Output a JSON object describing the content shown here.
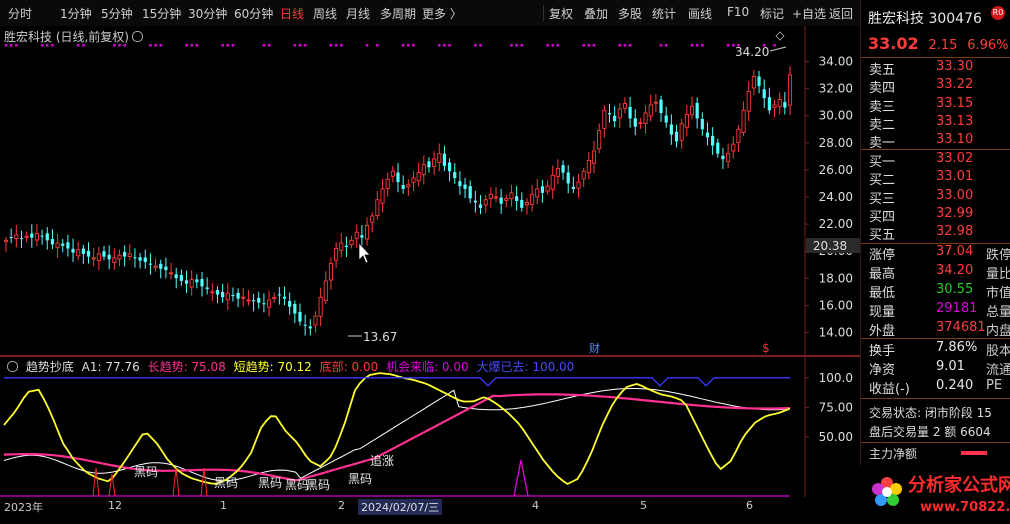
{
  "toolbar": {
    "left": [
      "分时",
      "1分钟",
      "5分钟",
      "15分钟",
      "30分钟",
      "60分钟",
      "日线",
      "周线",
      "月线",
      "多周期",
      "更多 〉"
    ],
    "active": "日线",
    "right": [
      "复权",
      "叠加",
      "多股",
      "统计",
      "画线",
      "F10",
      "标记",
      "+自选",
      "返回"
    ]
  },
  "chart_title": "胜宏科技 (日线,前复权)",
  "stock": {
    "name": "胜宏科技",
    "code": "300476",
    "badge": "R0",
    "price": "33.02",
    "change": "2.15",
    "pct": "6.96%"
  },
  "orderbook": {
    "asks": [
      {
        "label": "卖五",
        "price": "33.30"
      },
      {
        "label": "卖四",
        "price": "33.22"
      },
      {
        "label": "卖三",
        "price": "33.15"
      },
      {
        "label": "卖二",
        "price": "33.13"
      },
      {
        "label": "卖一",
        "price": "33.10"
      }
    ],
    "bids": [
      {
        "label": "买一",
        "price": "33.02"
      },
      {
        "label": "买二",
        "price": "33.01"
      },
      {
        "label": "买三",
        "price": "33.00"
      },
      {
        "label": "买四",
        "price": "32.99"
      },
      {
        "label": "买五",
        "price": "32.98"
      }
    ]
  },
  "quote": [
    {
      "label": "涨停",
      "value": "37.04",
      "color": "red",
      "extra": "跌停"
    },
    {
      "label": "最高",
      "value": "34.20",
      "color": "red",
      "extra": "量比"
    },
    {
      "label": "最低",
      "value": "30.55",
      "color": "green",
      "extra": "市值"
    },
    {
      "label": "现量",
      "value": "29181",
      "color": "purple",
      "extra": "总量"
    },
    {
      "label": "外盘",
      "value": "374681",
      "color": "red",
      "extra": "内盘"
    }
  ],
  "stats": [
    {
      "label": "换手",
      "value": "7.86%",
      "extra": "股本"
    },
    {
      "label": "净资",
      "value": "9.01",
      "extra": "流通"
    },
    {
      "label": "收益(-)",
      "value": "0.240",
      "extra": "PE"
    }
  ],
  "trading_state": "交易状态: 闭市阶段 15",
  "after_hours": "盘后交易量 2 额 6604",
  "main_net": "主力净额",
  "logo": {
    "text": "分析家公式网",
    "url": "www.70822.com"
  },
  "y_axis": {
    "ticks": [
      "34.00",
      "32.00",
      "30.00",
      "28.00",
      "26.00",
      "24.00",
      "22.00",
      "20.00",
      "18.00",
      "16.00",
      "14.00"
    ],
    "cursor": "20.38"
  },
  "annotations": {
    "high": "34.20",
    "low": "13.67",
    "cai": "财",
    "s": "$"
  },
  "indicator": {
    "name": "趋势抄底",
    "a1": "A1: 77.76",
    "long": "长趋势: 75.08",
    "short": "短趋势: 70.12",
    "bottom": "底部: 0.00",
    "chance": "机会来临: 0.00",
    "bigbuy": "大爆已去: 100.00",
    "ticks": [
      "100.0",
      "75.00",
      "50.00"
    ],
    "labels": [
      "黑码",
      "黑码",
      "黑码",
      "黑码",
      "黑码",
      "黑码",
      "追涨"
    ]
  },
  "x_axis": [
    "2023年",
    "12",
    "1",
    "2",
    "2024/02/07/三",
    "4",
    "5",
    "6"
  ],
  "chart_data": {
    "type": "candlestick",
    "title": "胜宏科技 (日线,前复权)",
    "ylim": [
      13.0,
      35.0
    ],
    "high": 34.2,
    "low": 13.67,
    "close_approx": [
      20.8,
      21.0,
      21.2,
      20.9,
      21.1,
      21.0,
      21.3,
      21.1,
      20.8,
      20.5,
      20.6,
      20.4,
      20.2,
      19.9,
      20.1,
      19.8,
      19.6,
      19.5,
      19.8,
      19.6,
      19.4,
      19.5,
      19.7,
      19.6,
      19.8,
      19.5,
      19.3,
      19.2,
      19.0,
      18.9,
      18.7,
      18.6,
      18.4,
      18.0,
      17.8,
      17.6,
      17.9,
      17.7,
      17.4,
      17.2,
      17.0,
      16.8,
      16.6,
      16.9,
      16.7,
      16.5,
      16.6,
      16.4,
      16.3,
      16.2,
      16.1,
      16.4,
      16.6,
      16.8,
      16.5,
      15.9,
      15.4,
      14.8,
      14.5,
      14.3,
      15.2,
      16.6,
      17.8,
      19.1,
      20.2,
      20.6,
      20.3,
      20.8,
      21.4,
      21.0,
      21.9,
      22.6,
      23.8,
      24.6,
      25.3,
      25.9,
      25.1,
      24.6,
      24.9,
      25.4,
      25.8,
      26.4,
      26.2,
      26.8,
      27.2,
      26.3,
      25.9,
      25.4,
      24.8,
      24.6,
      23.9,
      23.6,
      23.2,
      23.8,
      24.2,
      24.0,
      23.5,
      23.9,
      24.3,
      23.7,
      23.2,
      23.6,
      24.2,
      24.6,
      24.3,
      24.8,
      25.6,
      26.1,
      25.8,
      25.0,
      24.6,
      25.1,
      25.9,
      26.7,
      27.4,
      28.9,
      30.4,
      30.1,
      29.6,
      30.5,
      30.9,
      29.8,
      29.2,
      29.5,
      30.2,
      30.8,
      31.0,
      30.2,
      29.5,
      28.6,
      28.1,
      29.4,
      30.1,
      30.7,
      29.8,
      29.0,
      28.4,
      27.8,
      27.2,
      26.8,
      27.2,
      27.9,
      29.0,
      30.4,
      31.8,
      32.9,
      32.2,
      31.3,
      30.4,
      30.8,
      31.2,
      30.6,
      33.02
    ],
    "indicator_series": [
      {
        "name": "A1",
        "color": "#ffff30"
      },
      {
        "name": "长趋势",
        "color": "#ff3090"
      },
      {
        "name": "短趋势",
        "color": "#ffffff"
      },
      {
        "name": "大爆已去",
        "color": "#3a3aff"
      }
    ],
    "indicator_ylim": [
      0,
      110
    ]
  }
}
